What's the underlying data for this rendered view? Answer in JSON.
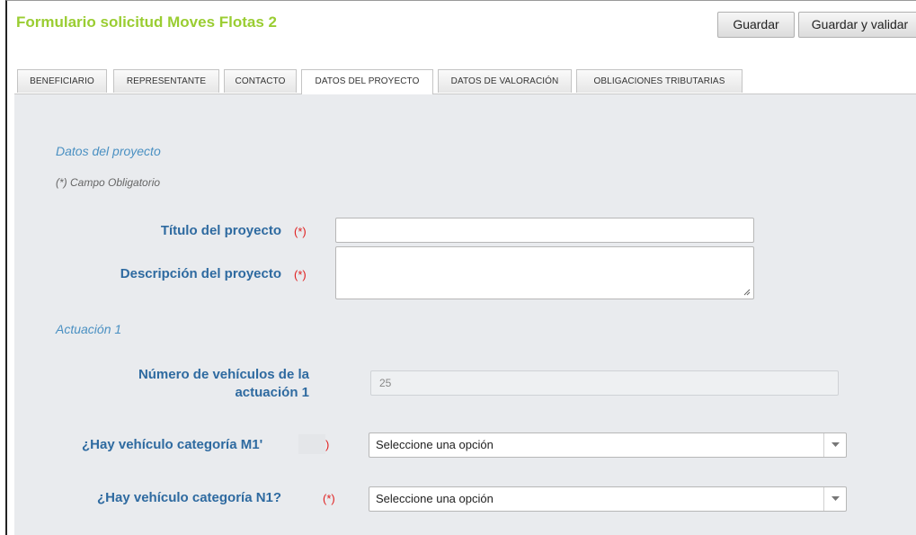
{
  "app": {
    "title": "Formulario solicitud Moves Flotas 2"
  },
  "toolbar": {
    "save_label": "Guardar",
    "save_validate_label": "Guardar y validar"
  },
  "tabs": [
    {
      "label": "BENEFICIARIO",
      "active": false
    },
    {
      "label": "REPRESENTANTE",
      "active": false
    },
    {
      "label": "CONTACTO",
      "active": false
    },
    {
      "label": "DATOS DEL PROYECTO",
      "active": true
    },
    {
      "label": "DATOS DE VALORACIÓN",
      "active": false
    },
    {
      "label": "OBLIGACIONES TRIBUTARIAS",
      "active": false
    }
  ],
  "form": {
    "section_title": "Datos del proyecto",
    "required_note": "(*) Campo Obligatorio",
    "required_mark": "(*)",
    "project_title": {
      "label": "Título del proyecto",
      "value": ""
    },
    "project_description": {
      "label": "Descripción del proyecto",
      "value": ""
    },
    "actuacion": {
      "title": "Actuación 1",
      "vehicles_label_line1": "Número de vehículos de la",
      "vehicles_label_line2": "actuación 1",
      "vehicles_value": "25",
      "m1_label": "¿Hay vehículo categoría M1'",
      "m1_required_mark": ")",
      "m1_value": "Seleccione una opción",
      "n1_label": "¿Hay vehículo categoría N1?",
      "n1_value": "Seleccione una opción"
    }
  },
  "colors": {
    "title_green": "#9acd32",
    "label_blue": "#2e6aa0",
    "section_blue": "#4a90c2",
    "required_red": "#e02020",
    "panel_bg": "#e9ebee"
  }
}
